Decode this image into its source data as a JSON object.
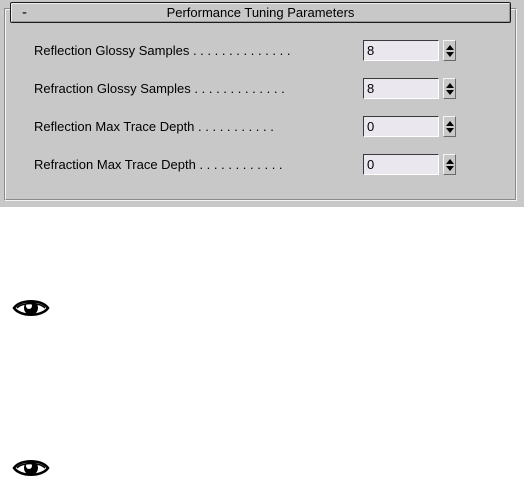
{
  "rollout": {
    "collapse_symbol": "-",
    "title": "Performance Tuning Parameters"
  },
  "params": [
    {
      "label": "Reflection Glossy Samples . . . . . . . . . . . . . .",
      "value": "8"
    },
    {
      "label": "Refraction Glossy Samples . . . . . . . . . . . . .",
      "value": "8"
    },
    {
      "label": "Reflection Max Trace Depth . . . . . . . . . . .",
      "value": "0"
    },
    {
      "label": "Refraction Max Trace Depth . . . . . . . . . . . .",
      "value": "0"
    }
  ],
  "icons": {
    "eye": "eye-icon",
    "spinner": "spinner-arrows-icon"
  },
  "colors": {
    "panel_bg": "#c8c8c8",
    "field_bg": "#eae7ee"
  }
}
